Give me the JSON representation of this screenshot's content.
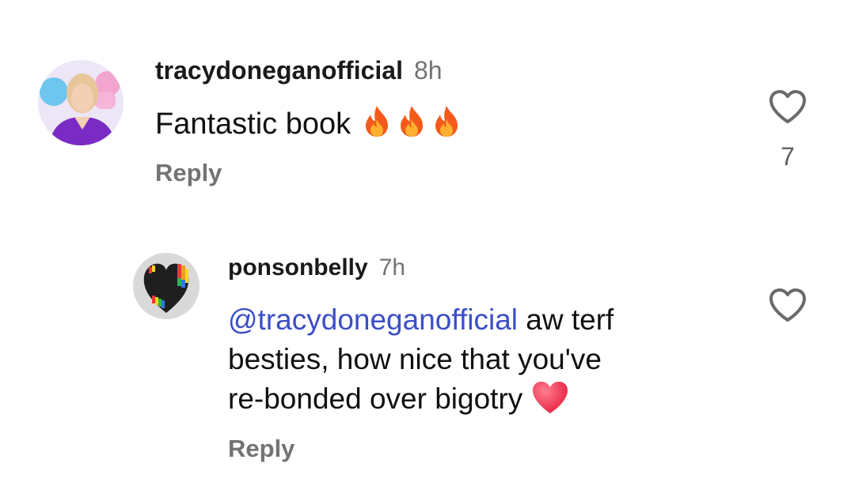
{
  "comments": [
    {
      "username": "tracydoneganofficial",
      "time": "8h",
      "text": "Fantastic book",
      "reply_label": "Reply",
      "like_count": "7"
    },
    {
      "username": "ponsonbelly",
      "time": "7h",
      "mention": "@tracydoneganofficial",
      "text_line1": " aw terf",
      "text_line2": "besties, how nice that you've",
      "text_line3": "re-bonded over bigotry",
      "reply_label": "Reply"
    }
  ],
  "colors": {
    "mention": "#3b4fc7",
    "muted": "#737373",
    "heart_emoji": "#f0344d"
  },
  "icons": [
    "fire-emoji",
    "red-heart-emoji",
    "heart-outline-icon"
  ]
}
